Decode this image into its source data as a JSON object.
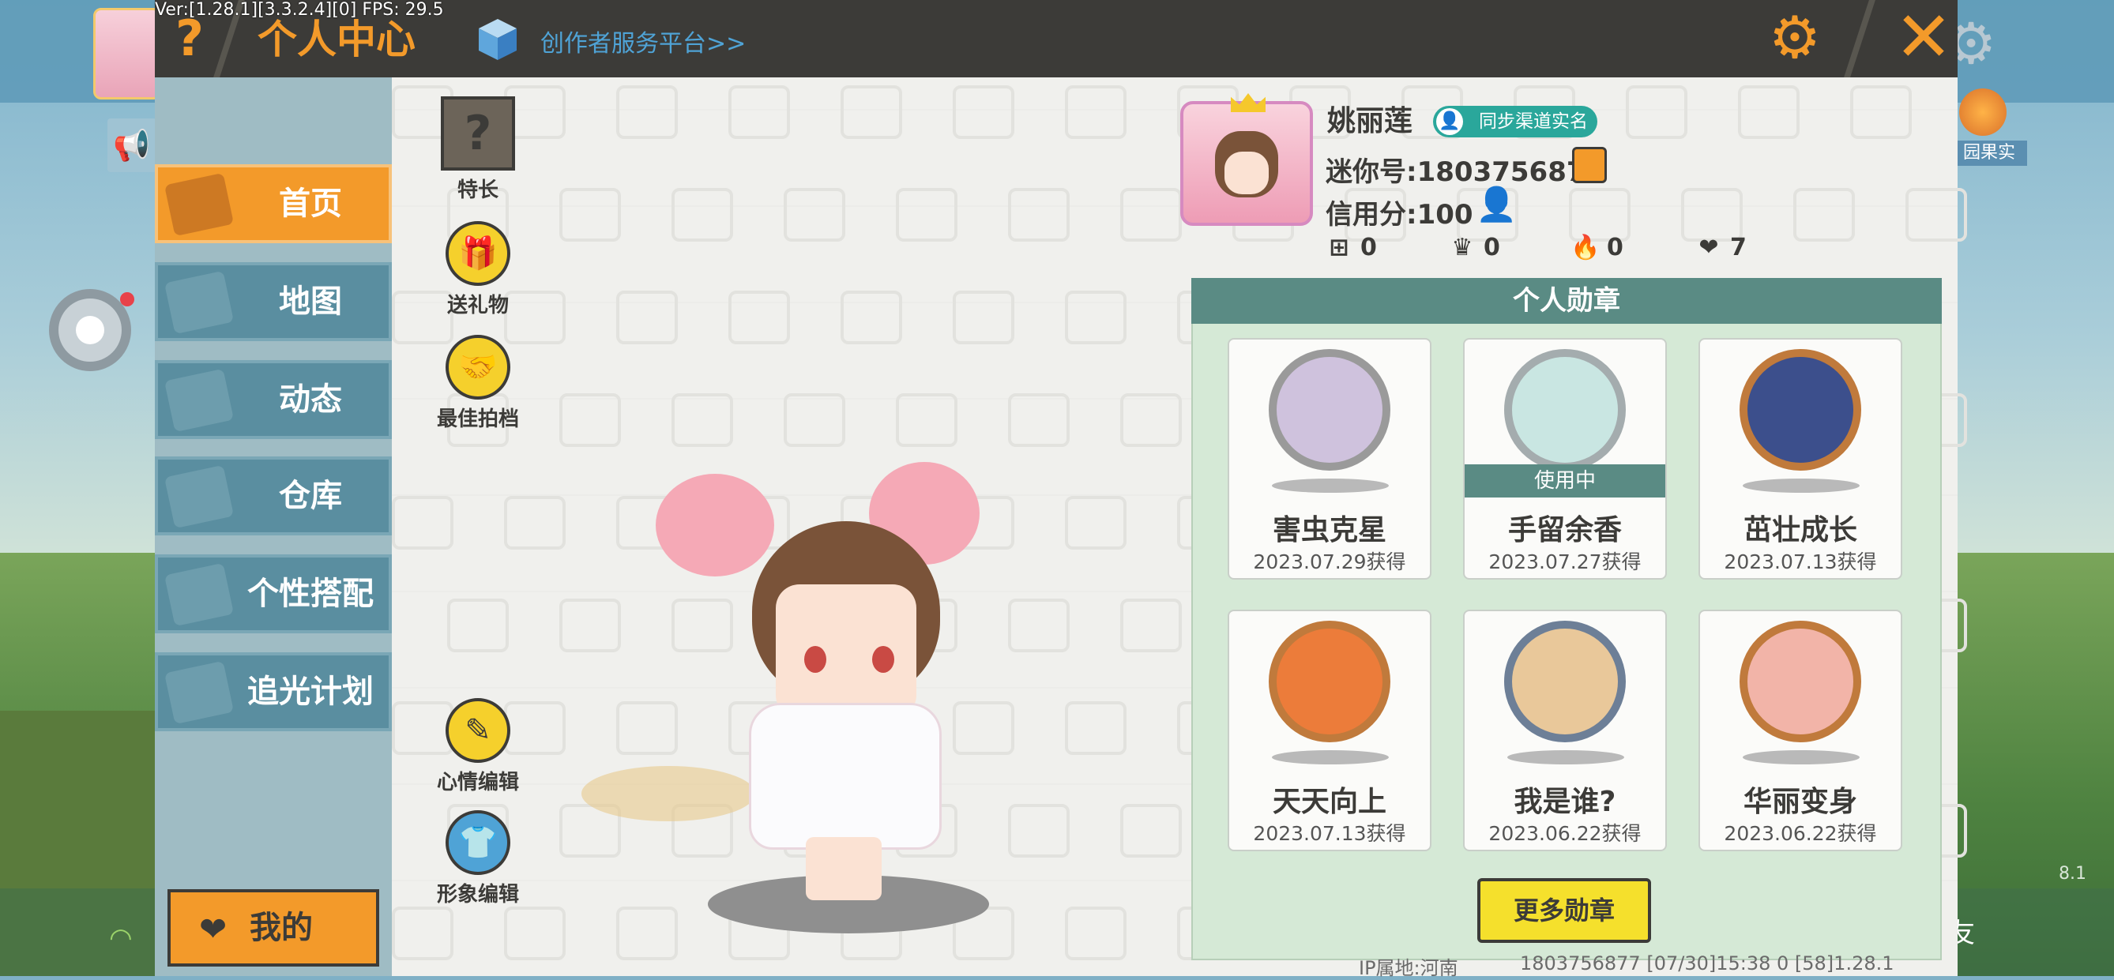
{
  "debug": {
    "version": "Ver:[1.28.1][3.3.2.4][0] FPS: 29.5"
  },
  "titlebar": {
    "help_icon": "?",
    "title": "个人中心",
    "creator_link": "创作者服务平台>>"
  },
  "sidebar": {
    "items": [
      {
        "label": "首页",
        "active": true
      },
      {
        "label": "地图"
      },
      {
        "label": "动态"
      },
      {
        "label": "仓库"
      },
      {
        "label": "个性搭配"
      },
      {
        "label": "追光计划"
      }
    ],
    "mine_label": "我的"
  },
  "actions": {
    "talent": "特长",
    "gift": "送礼物",
    "partner": "最佳拍档",
    "mood": "心情编辑",
    "image": "形象编辑"
  },
  "profile": {
    "name": "姚丽莲",
    "realname_badge": "同步渠道实名",
    "uid": "迷你号:1803756877",
    "credit": "信用分:100",
    "stats": [
      {
        "icon": "plus-square-icon",
        "value": "0"
      },
      {
        "icon": "cheer-icon",
        "value": "0"
      },
      {
        "icon": "flame-icon",
        "value": "0"
      },
      {
        "icon": "hearts-icon",
        "value": "7"
      }
    ]
  },
  "medals": {
    "header": "个人勋章",
    "items": [
      {
        "name": "害虫克星",
        "date": "2023.07.29获得",
        "color": "#8c8c8c"
      },
      {
        "name": "手留余香",
        "date": "2023.07.27获得",
        "color": "#9ea8ab",
        "using": "使用中"
      },
      {
        "name": "茁壮成长",
        "date": "2023.07.13获得",
        "color": "#c07a3c"
      },
      {
        "name": "天天向上",
        "date": "2023.07.13获得",
        "color": "#c07a3c"
      },
      {
        "name": "我是谁?",
        "date": "2023.06.22获得",
        "color": "#6d7f97"
      },
      {
        "name": "华丽变身",
        "date": "2023.06.22获得",
        "color": "#c07a3c"
      }
    ],
    "more_button": "更多勋章"
  },
  "footer": {
    "ip": "IP属地:河南",
    "info": "1803756877   [07/30]15:38 0   [58]1.28.1"
  },
  "background": {
    "fruit_label": "园果实",
    "fragment": "8.1",
    "fragment2": "友"
  }
}
